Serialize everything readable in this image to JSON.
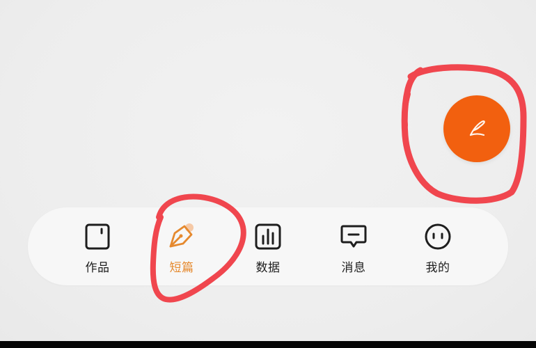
{
  "screen": {
    "background_color": "#efefef"
  },
  "fab": {
    "icon": "feather-quill-icon",
    "color": "#f2600f"
  },
  "tabbar": {
    "items": [
      {
        "id": "works",
        "label": "作品",
        "icon": "book-icon",
        "active": false
      },
      {
        "id": "short",
        "label": "短篇",
        "icon": "pen-nib-icon",
        "active": true,
        "badge": "dot"
      },
      {
        "id": "data",
        "label": "数据",
        "icon": "bar-chart-icon",
        "active": false
      },
      {
        "id": "messages",
        "label": "消息",
        "icon": "message-icon",
        "active": false
      },
      {
        "id": "me",
        "label": "我的",
        "icon": "smiley-face-icon",
        "active": false
      }
    ],
    "active_color": "#e5892e",
    "inactive_color": "#1e1e1e"
  },
  "annotations": {
    "marker_color": "#f0464e",
    "circled": [
      "fab",
      "tab-short"
    ]
  }
}
